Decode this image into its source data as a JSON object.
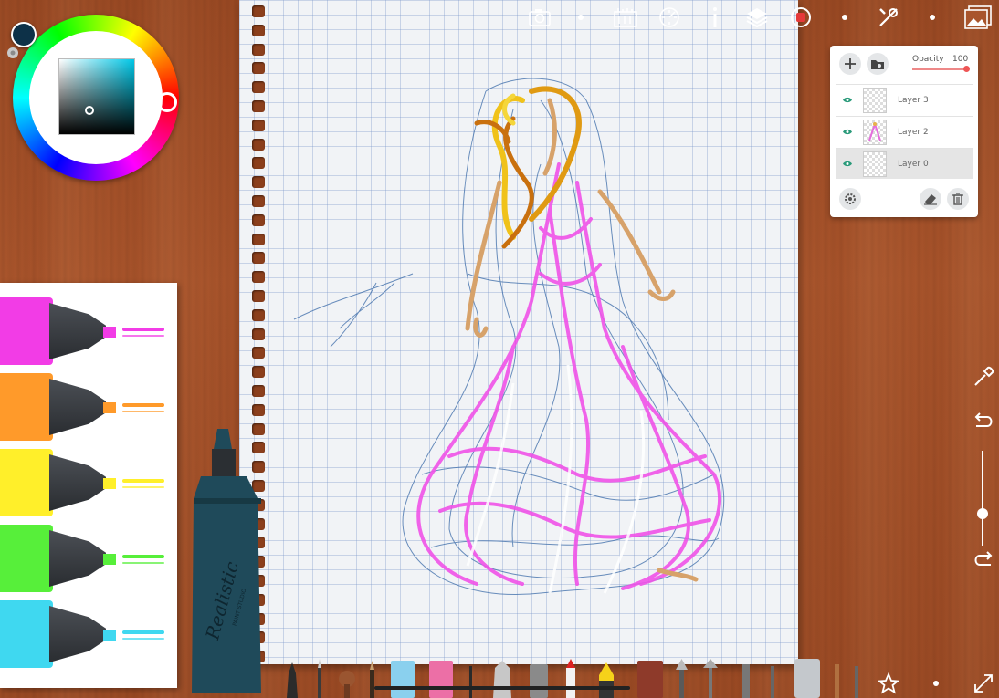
{
  "app": {
    "name": "Realistic Paint Studio"
  },
  "top_toolbar": {
    "icons": [
      "camera-icon",
      "ruler-icon",
      "reference-icon",
      "info-icon",
      "layers-icon",
      "record-icon",
      "tools-icon",
      "gallery-icon"
    ]
  },
  "color_picker": {
    "current_color": "#0d3148",
    "square_hue_color": "#00c8e8"
  },
  "layers_panel": {
    "opacity_label": "Opacity",
    "opacity_value": "100",
    "opacity_fraction": 1.0,
    "layers": [
      {
        "name": "Layer 3",
        "visible": true,
        "selected": false
      },
      {
        "name": "Layer 2",
        "visible": true,
        "selected": false
      },
      {
        "name": "Layer 0",
        "visible": true,
        "selected": true
      }
    ]
  },
  "marker_tray": {
    "colors": [
      "#f23ce6",
      "#ff9a2a",
      "#ffef2a",
      "#57ef3a",
      "#3fd8f0"
    ]
  },
  "big_marker": {
    "brand_text": "Realistic",
    "brand_subtext": "PAINT STUDIO",
    "color": "#1f4a5a"
  },
  "brush_size_fraction": 0.62
}
